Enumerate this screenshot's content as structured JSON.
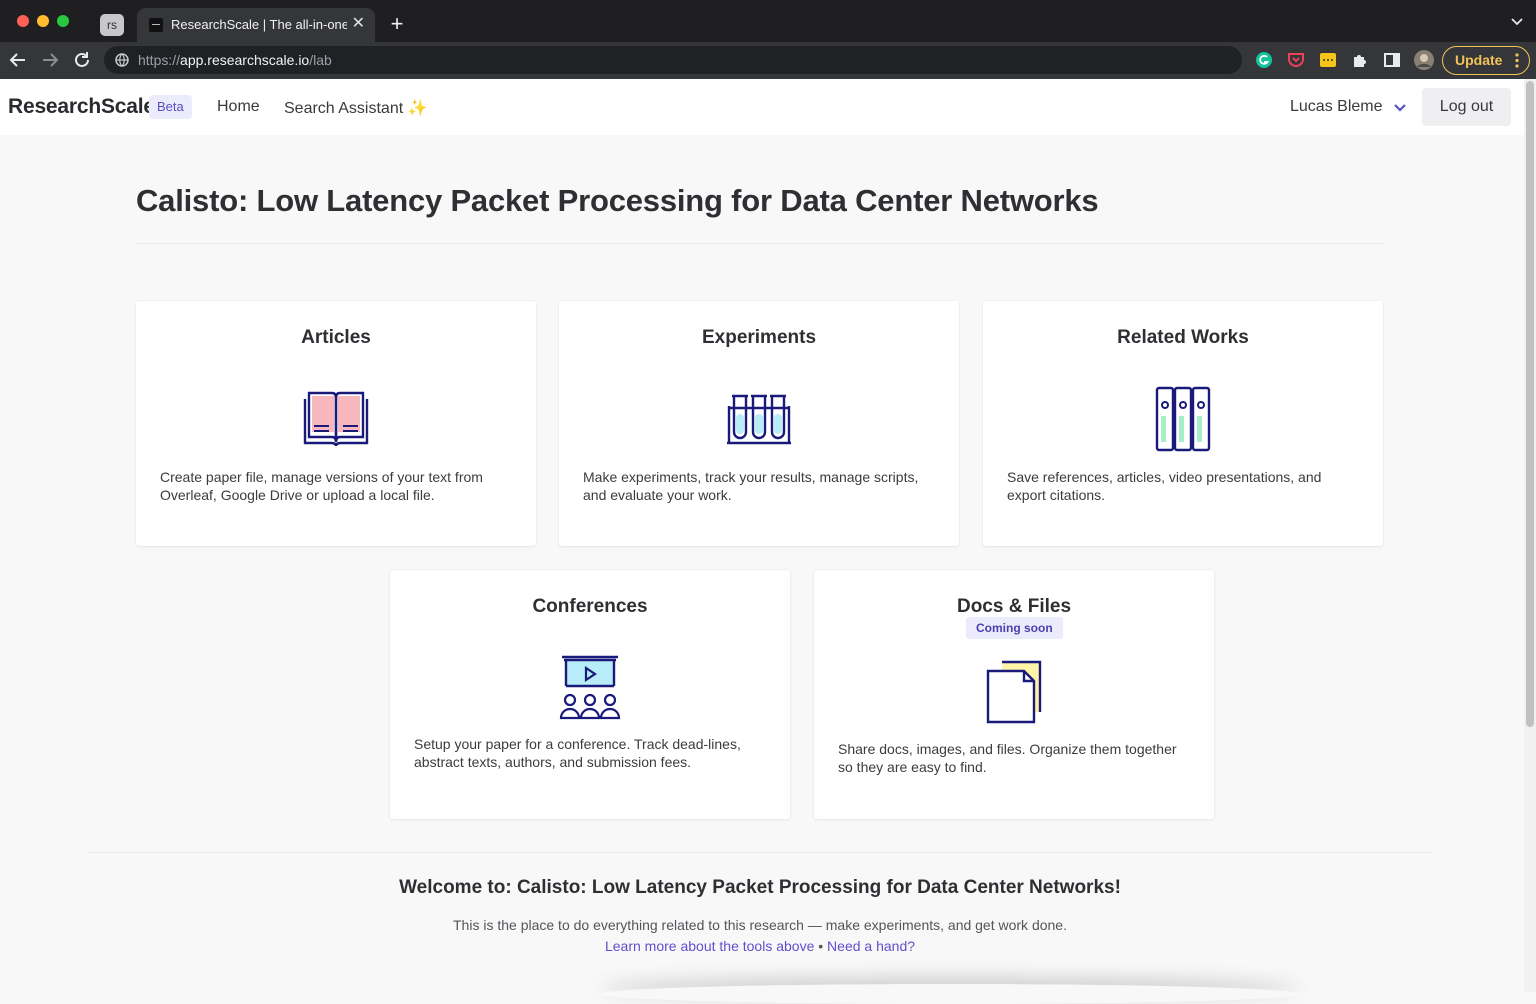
{
  "browser": {
    "pinned_tab": "rs",
    "active_tab_title": "ResearchScale | The all-in-one",
    "url_scheme": "https://",
    "url_host": "app.researchscale.io",
    "url_path": "/lab",
    "update_label": "Update"
  },
  "header": {
    "brand": "ResearchScale",
    "badge": "Beta",
    "nav": [
      "Home",
      "Search Assistant ✨"
    ],
    "user": "Lucas Bleme",
    "logout": "Log out"
  },
  "page": {
    "title": "Calisto: Low Latency Packet Processing for Data Center Networks"
  },
  "cards": [
    {
      "title": "Articles",
      "icon": "open-book-icon",
      "description": "Create paper file, manage versions of your text from Overleaf, Google Drive or upload a local file."
    },
    {
      "title": "Experiments",
      "icon": "test-tubes-icon",
      "description": "Make experiments, track your results, manage scripts, and evaluate your work."
    },
    {
      "title": "Related Works",
      "icon": "binders-icon",
      "description": "Save references, articles, video presentations, and export citations."
    },
    {
      "title": "Conferences",
      "icon": "presentation-audience-icon",
      "description": "Setup your paper for a conference. Track dead-lines, abstract texts, authors, and submission fees."
    },
    {
      "title": "Docs & Files",
      "icon": "documents-icon",
      "badge": "Coming soon",
      "description": "Share docs, images, and files. Organize them together so they are easy to find."
    }
  ],
  "welcome": {
    "title": "Welcome to: Calisto: Low Latency Packet Processing for Data Center Networks!",
    "subtitle": "This is the place to do everything related to this research — make experiments, and get work done.",
    "link_learn": "Learn more about the tools above",
    "separator": "•",
    "link_help": "Need a hand?"
  },
  "colors": {
    "accent": "#6150c9",
    "icon_stroke": "#1a1a7a",
    "icon_pink": "#f7b7bd",
    "icon_green": "#a8efc8",
    "icon_cyan": "#b8ecf8",
    "icon_yellow": "#fff3a8"
  }
}
